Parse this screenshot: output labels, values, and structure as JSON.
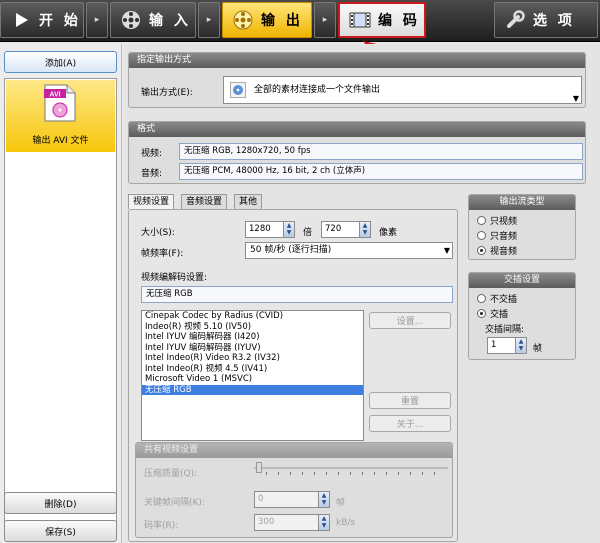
{
  "toolbar": {
    "start": "开 始",
    "input": "输 入",
    "output": "输 出",
    "encode": "编 码",
    "options": "选 项",
    "sep": "▸"
  },
  "left": {
    "add_label": "添加(A)",
    "file_item_label": "输出 AVI 文件",
    "avi_badge": "AVI",
    "delete_label": "删除(D)",
    "save_label": "保存(S)"
  },
  "output_mode": {
    "title": "指定输出方式",
    "label": "输出方式(E):",
    "value": "全部的素材连接成一个文件输出"
  },
  "format": {
    "title": "格式",
    "video_label": "视频:",
    "video_value": "无压缩 RGB, 1280x720, 50 fps",
    "audio_label": "音频:",
    "audio_value": "无压缩 PCM, 48000 Hz, 16 bit, 2 ch (立体声)"
  },
  "tabs": [
    "视频设置",
    "音频设置",
    "其他"
  ],
  "video_settings": {
    "size_label": "大小(S):",
    "width": "1280",
    "times": "倍",
    "height": "720",
    "pixels": "像素",
    "framerate_label": "帧频率(F):",
    "framerate_value": "50 帧/秒 (逐行扫描)",
    "codec_label": "视频编解码设置:",
    "codec_value": "无压缩 RGB",
    "codecs": [
      "Cinepak Codec by Radius (CVID)",
      "Indeo(R) 视频 5.10 (IV50)",
      "Intel IYUV 编码解码器 (I420)",
      "Intel IYUV 编码解码器 (IYUV)",
      "Intel Indeo(R) Video R3.2 (IV32)",
      "Intel Indeo(R) 视频 4.5 (IV41)",
      "Microsoft Video 1 (MSVC)",
      "无压缩 RGB"
    ],
    "settings_btn": "设置...",
    "reset_btn": "重置",
    "about_btn": "关于..."
  },
  "common": {
    "title": "共有视频设置",
    "quality_label": "压缩质量(Q):",
    "keyframe_label": "关键帧间隔(K):",
    "keyframe_value": "0",
    "keyframe_unit": "帧",
    "bitrate_label": "码率(R):",
    "bitrate_value": "300",
    "bitrate_unit": "kB/s"
  },
  "stream_type": {
    "title": "输出流类型",
    "options": [
      "只视频",
      "只音频",
      "视音频"
    ],
    "selected_index": 2
  },
  "interleave": {
    "title": "交插设置",
    "options": [
      "不交插",
      "交插"
    ],
    "selected_index": 1,
    "interval_label": "交插间隔:",
    "interval_value": "1",
    "interval_unit": "帧"
  }
}
